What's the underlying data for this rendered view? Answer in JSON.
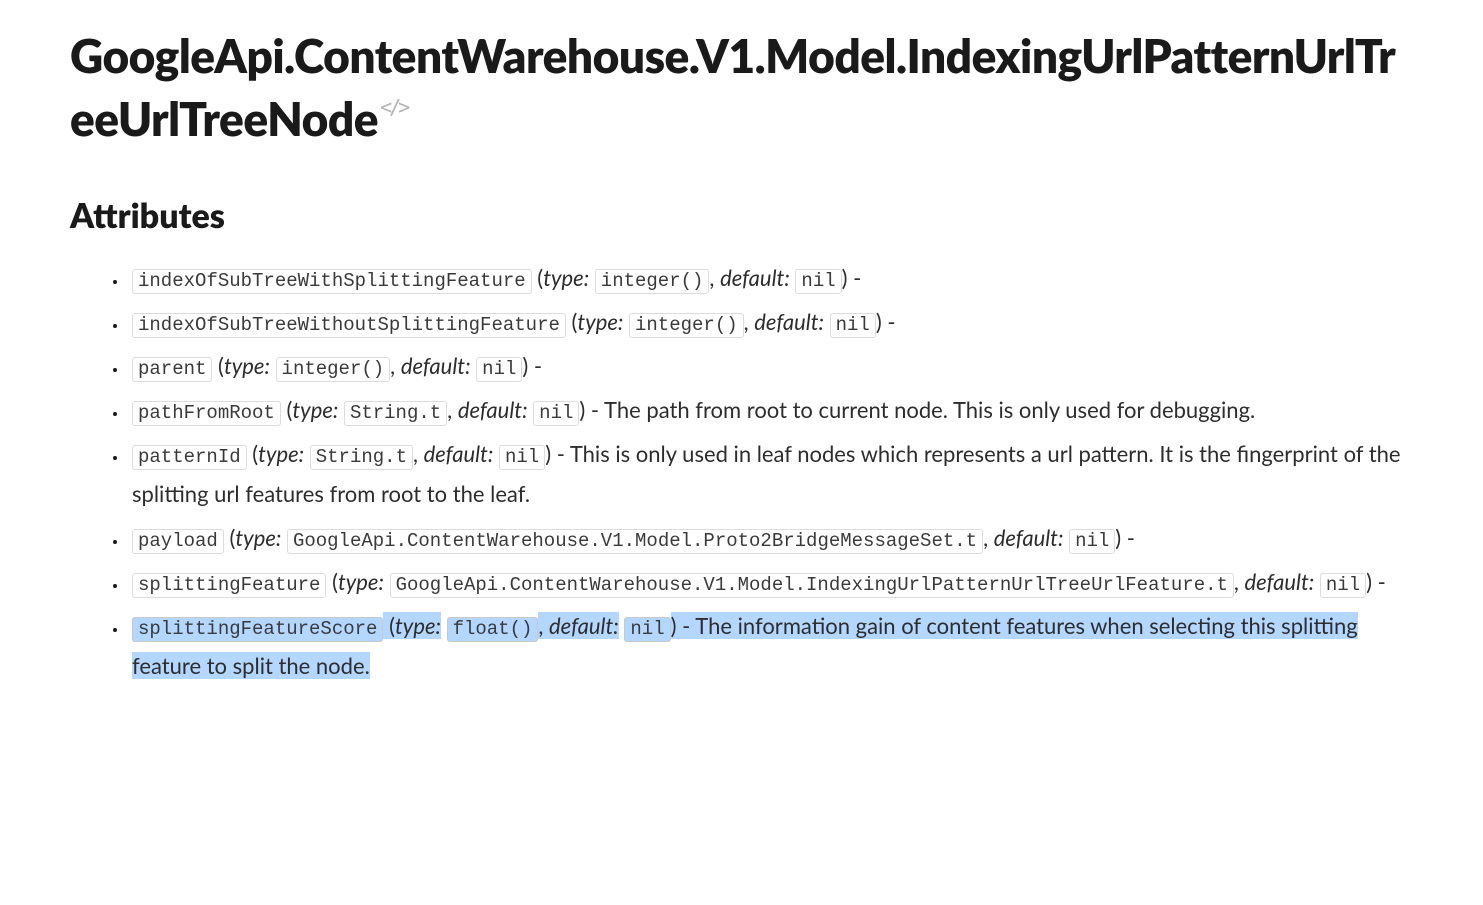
{
  "title": "GoogleApi.ContentWarehouse.V1.Model.IndexingUrlPatternUrlTreeUrlTreeNode",
  "section": "Attributes",
  "labels": {
    "type": "type:",
    "default": "default:"
  },
  "items": [
    {
      "name": "indexOfSubTreeWithSplittingFeature",
      "type": "integer()",
      "default": "nil",
      "desc": ""
    },
    {
      "name": "indexOfSubTreeWithoutSplittingFeature",
      "type": "integer()",
      "default": "nil",
      "desc": ""
    },
    {
      "name": "parent",
      "type": "integer()",
      "default": "nil",
      "desc": ""
    },
    {
      "name": "pathFromRoot",
      "type": "String.t",
      "default": "nil",
      "desc": "The path from root to current node. This is only used for debugging."
    },
    {
      "name": "patternId",
      "type": "String.t",
      "default": "nil",
      "desc": "This is only used in leaf nodes which represents a url pattern. It is the fingerprint of the splitting url features from root to the leaf."
    },
    {
      "name": "payload",
      "type": "GoogleApi.ContentWarehouse.V1.Model.Proto2BridgeMessageSet.t",
      "default": "nil",
      "desc": ""
    },
    {
      "name": "splittingFeature",
      "type": "GoogleApi.ContentWarehouse.V1.Model.IndexingUrlPatternUrlTreeUrlFeature.t",
      "default": "nil",
      "desc": ""
    },
    {
      "name": "splittingFeatureScore",
      "type": "float()",
      "default": "nil",
      "desc": "The information gain of content features when selecting this splitting feature to split the node.",
      "highlight": true
    }
  ]
}
